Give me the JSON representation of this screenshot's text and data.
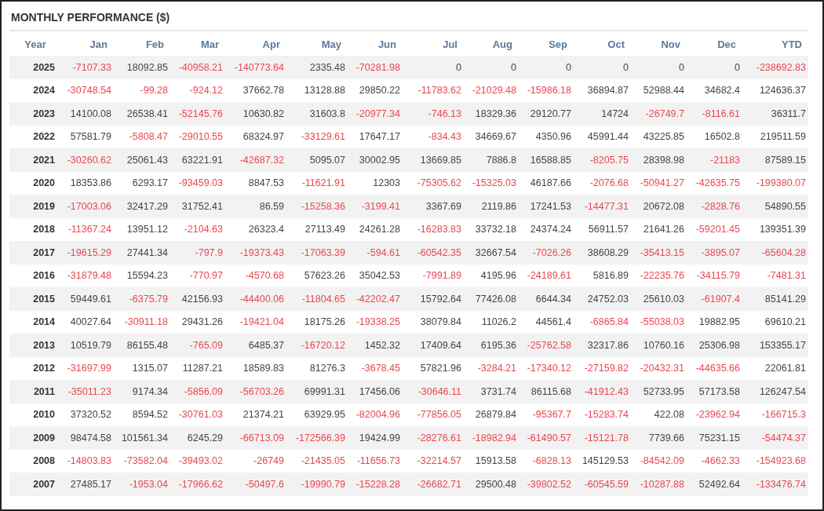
{
  "title": "MONTHLY PERFORMANCE ($)",
  "columns": [
    "Year",
    "Jan",
    "Feb",
    "Mar",
    "Apr",
    "May",
    "Jun",
    "Jul",
    "Aug",
    "Sep",
    "Oct",
    "Nov",
    "Dec",
    "YTD"
  ],
  "rows": [
    {
      "year": "2025",
      "values": [
        "-7107.33",
        "18092.85",
        "-40958.21",
        "-140773.64",
        "2335.48",
        "-70281.98",
        "0",
        "0",
        "0",
        "0",
        "0",
        "0",
        "-238692.83"
      ]
    },
    {
      "year": "2024",
      "values": [
        "-30748.54",
        "-99.28",
        "-924.12",
        "37662.78",
        "13128.88",
        "29850.22",
        "-11783.62",
        "-21029.48",
        "-15986.18",
        "36894.87",
        "52988.44",
        "34682.4",
        "124636.37"
      ]
    },
    {
      "year": "2023",
      "values": [
        "14100.08",
        "26538.41",
        "-52145.76",
        "10630.82",
        "31603.8",
        "-20977.34",
        "-746.13",
        "18329.36",
        "29120.77",
        "14724",
        "-26749.7",
        "-8116.61",
        "36311.7"
      ]
    },
    {
      "year": "2022",
      "values": [
        "57581.79",
        "-5808.47",
        "-29010.55",
        "68324.97",
        "-33129.61",
        "17647.17",
        "-834.43",
        "34669.67",
        "4350.96",
        "45991.44",
        "43225.85",
        "16502.8",
        "219511.59"
      ]
    },
    {
      "year": "2021",
      "values": [
        "-30260.62",
        "25061.43",
        "63221.91",
        "-42687.32",
        "5095.07",
        "30002.95",
        "13669.85",
        "7886.8",
        "16588.85",
        "-8205.75",
        "28398.98",
        "-21183",
        "87589.15"
      ]
    },
    {
      "year": "2020",
      "values": [
        "18353.86",
        "6293.17",
        "-93459.03",
        "8847.53",
        "-11621.91",
        "12303",
        "-75305.62",
        "-15325.03",
        "46187.66",
        "-2076.68",
        "-50941.27",
        "-42635.75",
        "-199380.07"
      ]
    },
    {
      "year": "2019",
      "values": [
        "-17003.06",
        "32417.29",
        "31752.41",
        "86.59",
        "-15258.36",
        "-3199.41",
        "3367.69",
        "2119.86",
        "17241.53",
        "-14477.31",
        "20672.08",
        "-2828.76",
        "54890.55"
      ]
    },
    {
      "year": "2018",
      "values": [
        "-11367.24",
        "13951.12",
        "-2104.63",
        "26323.4",
        "27113.49",
        "24261.28",
        "-16283.83",
        "33732.18",
        "24374.24",
        "56911.57",
        "21641.26",
        "-59201.45",
        "139351.39"
      ]
    },
    {
      "year": "2017",
      "values": [
        "-19615.29",
        "27441.34",
        "-797.9",
        "-19373.43",
        "-17063.39",
        "-594.61",
        "-60542.35",
        "32667.54",
        "-7026.26",
        "38608.29",
        "-35413.15",
        "-3895.07",
        "-65604.28"
      ]
    },
    {
      "year": "2016",
      "values": [
        "-31879.48",
        "15594.23",
        "-770.97",
        "-4570.68",
        "57623.26",
        "35042.53",
        "-7991.89",
        "4195.96",
        "-24189.61",
        "5816.89",
        "-22235.76",
        "-34115.79",
        "-7481.31"
      ]
    },
    {
      "year": "2015",
      "values": [
        "59449.61",
        "-6375.79",
        "42156.93",
        "-44400.06",
        "-11804.65",
        "-42202.47",
        "15792.64",
        "77426.08",
        "6644.34",
        "24752.03",
        "25610.03",
        "-61907.4",
        "85141.29"
      ]
    },
    {
      "year": "2014",
      "values": [
        "40027.64",
        "-30911.18",
        "29431.26",
        "-19421.04",
        "18175.26",
        "-19338.25",
        "38079.84",
        "11026.2",
        "44561.4",
        "-6865.84",
        "-55038.03",
        "19882.95",
        "69610.21"
      ]
    },
    {
      "year": "2013",
      "values": [
        "10519.79",
        "86155.48",
        "-765.09",
        "6485.37",
        "-16720.12",
        "1452.32",
        "17409.64",
        "6195.36",
        "-25762.58",
        "32317.86",
        "10760.16",
        "25306.98",
        "153355.17"
      ]
    },
    {
      "year": "2012",
      "values": [
        "-31697.99",
        "1315.07",
        "11287.21",
        "18589.83",
        "81276.3",
        "-3678.45",
        "57821.96",
        "-3284.21",
        "-17340.12",
        "-27159.82",
        "-20432.31",
        "-44635.66",
        "22061.81"
      ]
    },
    {
      "year": "2011",
      "values": [
        "-35011.23",
        "9174.34",
        "-5856.09",
        "-56703.26",
        "69991.31",
        "17456.06",
        "-30646.11",
        "3731.74",
        "86115.68",
        "-41912.43",
        "52733.95",
        "57173.58",
        "126247.54"
      ]
    },
    {
      "year": "2010",
      "values": [
        "37320.52",
        "8594.52",
        "-30761.03",
        "21374.21",
        "63929.95",
        "-82004.96",
        "-77856.05",
        "26879.84",
        "-95367.7",
        "-15283.74",
        "422.08",
        "-23962.94",
        "-166715.3"
      ]
    },
    {
      "year": "2009",
      "values": [
        "98474.58",
        "101561.34",
        "6245.29",
        "-66713.09",
        "-172566.39",
        "19424.99",
        "-28276.61",
        "-18982.94",
        "-61490.57",
        "-15121.78",
        "7739.66",
        "75231.15",
        "-54474.37"
      ]
    },
    {
      "year": "2008",
      "values": [
        "-14803.83",
        "-73582.04",
        "-39493.02",
        "-26749",
        "-21435.05",
        "-11656.73",
        "-32214.57",
        "15913.58",
        "-6828.13",
        "145129.53",
        "-84542.09",
        "-4662.33",
        "-154923.68"
      ]
    },
    {
      "year": "2007",
      "values": [
        "27485.17",
        "-1953.04",
        "-17966.62",
        "-50497.6",
        "-19990.79",
        "-15228.28",
        "-26682.71",
        "29500.48",
        "-39802.52",
        "-60545.59",
        "-10287.88",
        "52492.64",
        "-133476.74"
      ]
    }
  ]
}
